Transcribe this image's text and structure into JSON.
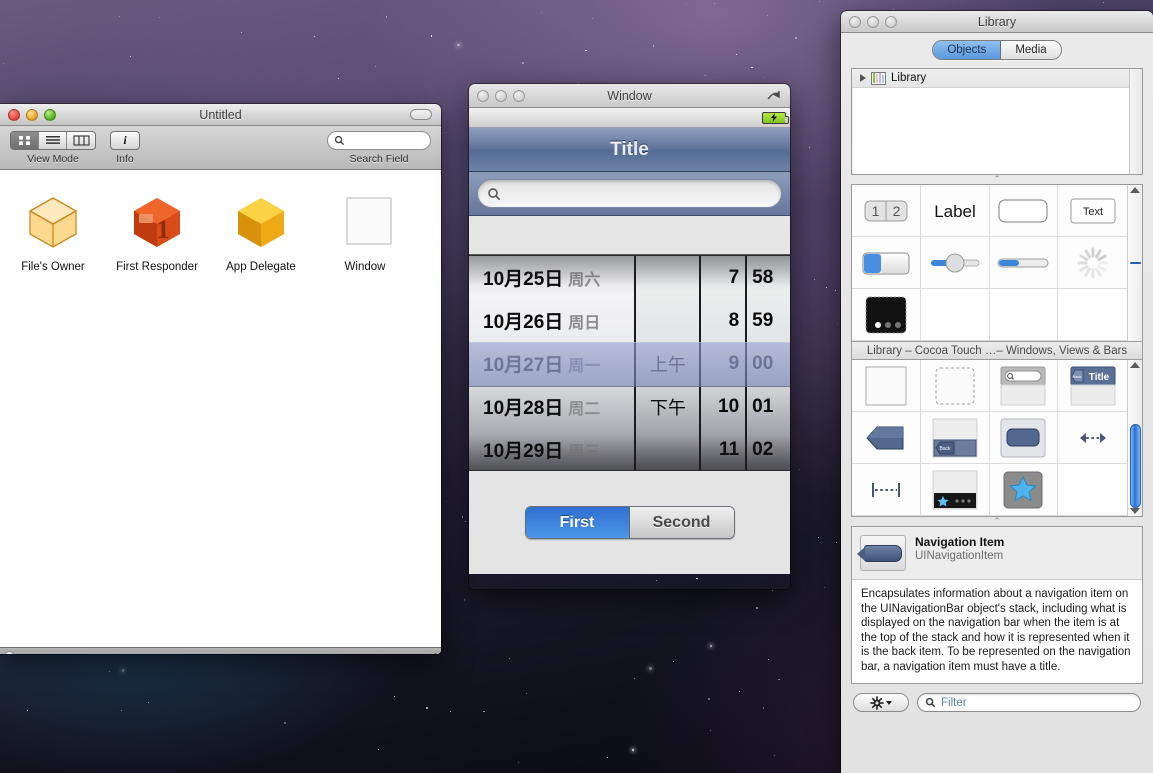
{
  "desktop": {
    "wallpaper": "space-nebula"
  },
  "doc_window": {
    "title": "Untitled",
    "toolbar": {
      "view_mode_label": "View Mode",
      "info_label": "Info",
      "search_field_label": "Search Field",
      "search_placeholder": "",
      "view_modes": [
        "icon-view",
        "list-view",
        "column-view"
      ],
      "active_view_mode": 0
    },
    "objects": [
      {
        "label": "File's Owner",
        "icon": "cube-outline-icon"
      },
      {
        "label": "First Responder",
        "icon": "first-responder-icon"
      },
      {
        "label": "App Delegate",
        "icon": "cube-icon"
      },
      {
        "label": "Window",
        "icon": "window-icon"
      }
    ]
  },
  "ui_window": {
    "title": "Window",
    "statusbar": {
      "battery": "battery-icon"
    },
    "navbar_title": "Title",
    "search_placeholder": "",
    "picker": {
      "date_column": [
        {
          "date": "10月25日",
          "weekday": "周六"
        },
        {
          "date": "10月26日",
          "weekday": "周日"
        },
        {
          "date": "10月27日",
          "weekday": "周一"
        },
        {
          "date": "10月28日",
          "weekday": "周二"
        },
        {
          "date": "10月29日",
          "weekday": "周三"
        }
      ],
      "ampm_column": [
        "",
        "",
        "上午",
        "下午",
        ""
      ],
      "hour_column": [
        "7",
        "8",
        "9",
        "10",
        "11"
      ],
      "minute_column": [
        "58",
        "59",
        "00",
        "01",
        "02"
      ],
      "selected_index": 2
    },
    "segmented": {
      "items": [
        "First",
        "Second"
      ],
      "selected": 0
    }
  },
  "library": {
    "title": "Library",
    "tabs": [
      {
        "label": "Objects",
        "selected": true
      },
      {
        "label": "Media",
        "selected": false
      }
    ],
    "outline": {
      "root_label": "Library"
    },
    "grid_top": [
      "segmented-control-icon",
      "label-icon",
      "text-field-icon",
      "text-view-icon",
      "switch-icon",
      "slider-icon",
      "progress-view-icon",
      "activity-indicator-icon",
      "page-control-icon",
      "",
      "",
      ""
    ],
    "section_header": "Library – Cocoa Touch …– Windows, Views & Bars",
    "grid_bottom": [
      "view-icon",
      "scroll-view-icon",
      "search-bar-icon",
      "navigation-bar-icon",
      "navigation-item-icon",
      "bar-button-item-icon",
      "toolbar-icon",
      "flexible-space-icon",
      "fixed-space-icon",
      "tab-bar-icon",
      "tab-bar-item-icon",
      ""
    ],
    "detail": {
      "name": "Navigation Item",
      "class": "UINavigationItem",
      "icon": "navigation-item-icon",
      "description": "Encapsulates information about a navigation item on the UINavigationBar object's stack, including what is displayed on the navigation bar when the item is at the top of the stack and how it is represented when it is the back item. To be represented on the navigation bar, a navigation item must have a title."
    },
    "footer": {
      "gear_label": "gear-icon",
      "filter_placeholder": "Filter",
      "filter_value": ""
    }
  },
  "colors": {
    "accent_blue": "#2f6fd0",
    "selection_blue": "#5b98dd",
    "navbar_blue": "#5d7097",
    "battery_green": "#7fc41c"
  }
}
